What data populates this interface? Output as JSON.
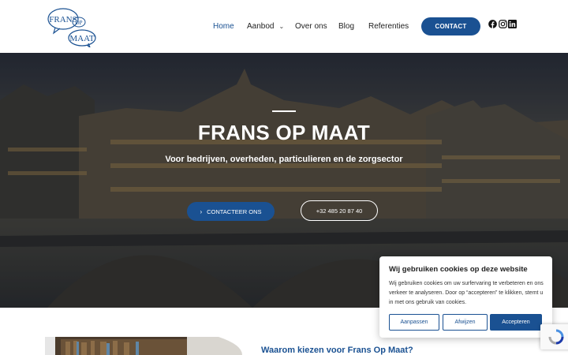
{
  "logo": {
    "line1": "FRANS",
    "line2": "OP",
    "line3": "MAAT"
  },
  "nav": {
    "home": "Home",
    "aanbod": "Aanbod",
    "over_ons": "Over ons",
    "blog": "Blog",
    "referenties": "Referenties",
    "contact": "CONTACT",
    "social_icons": [
      "facebook-icon",
      "instagram-icon",
      "linkedin-icon"
    ]
  },
  "hero": {
    "title": "FRANS OP MAAT",
    "subtitle": "Voor bedrijven, overheden, particulieren en de zorgsector",
    "cta_primary": "CONTACTEER ONS",
    "cta_phone": "+32 485 20 87 40"
  },
  "section": {
    "why_title": "Waarom kiezen voor Frans Op Maat?"
  },
  "cookie": {
    "title": "Wij gebruiken cookies op deze website",
    "text": "Wij gebruiken cookies om uw surfervaring te verbeteren en ons verkeer te analyseren. Door op “accepteren” te klikken, stemt u in met ons gebruik van cookies.",
    "btn_customize": "Aanpassen",
    "btn_reject": "Afwijzen",
    "btn_accept": "Accepteren"
  },
  "colors": {
    "brand": "#1a5192",
    "text": "#1f1f1f",
    "white": "#ffffff"
  }
}
